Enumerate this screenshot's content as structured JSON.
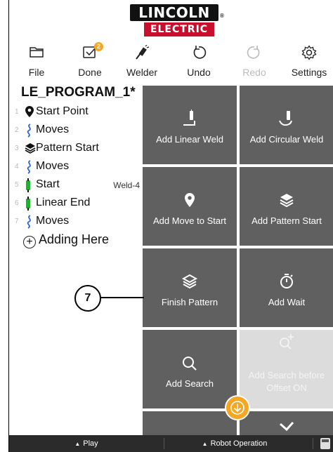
{
  "logo": {
    "top": "LINCOLN",
    "bottom": "ELECTRIC",
    "reg": "®"
  },
  "toolbar": {
    "file": "File",
    "done": "Done",
    "done_badge": "2",
    "welder": "Welder",
    "undo": "Undo",
    "redo": "Redo",
    "settings": "Settings"
  },
  "program": {
    "title": "LE_PROGRAM_1*",
    "rows": [
      {
        "num": "1",
        "label": "Start Point",
        "icon": "location-pin-icon",
        "tag": ""
      },
      {
        "num": "2",
        "label": "Moves",
        "icon": "squiggle-path-icon",
        "tag": ""
      },
      {
        "num": "3",
        "label": "Pattern Start",
        "icon": "layers-icon",
        "tag": ""
      },
      {
        "num": "4",
        "label": "Moves",
        "icon": "squiggle-path-icon",
        "tag": ""
      },
      {
        "num": "5",
        "label": "Start",
        "icon": "weld-torch-icon",
        "tag": "Weld-4"
      },
      {
        "num": "6",
        "label": "Linear End",
        "icon": "weld-torch-icon",
        "tag": ""
      },
      {
        "num": "7",
        "label": "Moves",
        "icon": "squiggle-path-icon",
        "tag": ""
      }
    ],
    "adding": "Adding Here"
  },
  "tiles": {
    "add_linear_weld": "Add Linear Weld",
    "add_circular_weld": "Add Circular Weld",
    "add_move_to_start": "Add Move to Start",
    "add_pattern_start": "Add Pattern Start",
    "finish_pattern": "Finish Pattern",
    "add_wait": "Add Wait",
    "add_search": "Add Search",
    "add_search_before_offset": "Add Search before Offset ON"
  },
  "bottom": {
    "play": "Play",
    "robot_operation": "Robot Operation"
  },
  "callout": "7",
  "colors": {
    "accent": "#f5a623",
    "tile": "#606060",
    "brand_red": "#c8102e",
    "weld_green": "#1db32b",
    "path_blue": "#2a63d6"
  }
}
